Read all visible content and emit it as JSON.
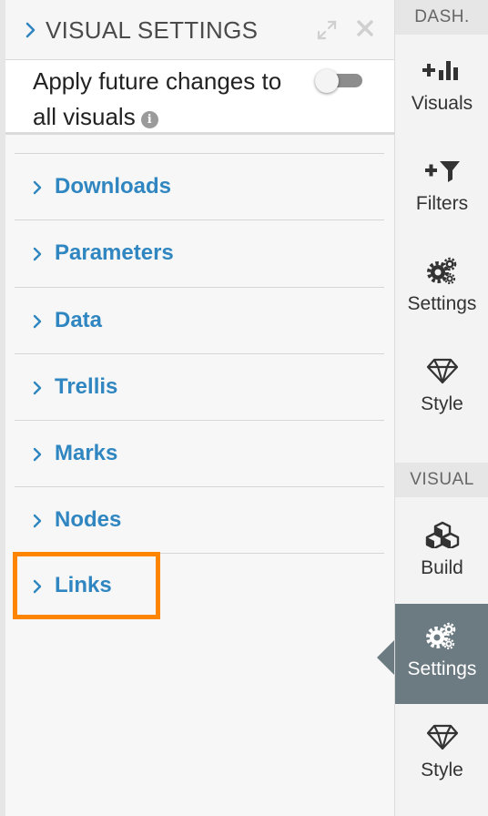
{
  "panel": {
    "title": "VISUAL SETTINGS",
    "apply_text": "Apply future changes to all visuals",
    "apply_toggle_on": false,
    "sections": [
      {
        "label": "Downloads"
      },
      {
        "label": "Parameters"
      },
      {
        "label": "Data"
      },
      {
        "label": "Trellis"
      },
      {
        "label": "Marks"
      },
      {
        "label": "Nodes"
      },
      {
        "label": "Links",
        "highlighted": true
      }
    ],
    "highlight_color": "#ff8400",
    "link_color": "#2f86c0"
  },
  "rail": {
    "dash_section": "DASH.",
    "visual_section": "VISUAL",
    "dash_buttons": [
      {
        "label": "Visuals",
        "icon": "add-visual-icon"
      },
      {
        "label": "Filters",
        "icon": "add-filter-icon"
      },
      {
        "label": "Settings",
        "icon": "gears-icon"
      },
      {
        "label": "Style",
        "icon": "diamond-icon"
      }
    ],
    "visual_buttons": [
      {
        "label": "Build",
        "icon": "cubes-icon"
      },
      {
        "label": "Settings",
        "icon": "gears-icon",
        "active": true
      },
      {
        "label": "Style",
        "icon": "diamond-icon"
      }
    ],
    "active_color": "#6c7a82"
  }
}
